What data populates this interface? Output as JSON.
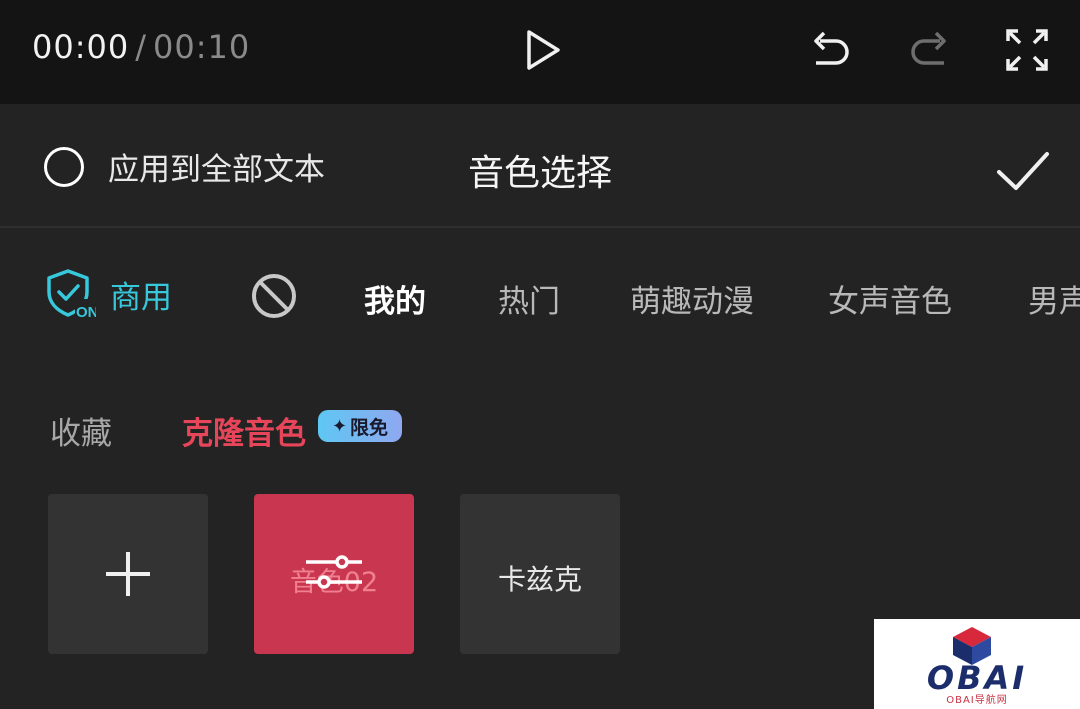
{
  "player": {
    "current_time": "00:00",
    "separator": "/",
    "total_time": "00:10"
  },
  "header": {
    "apply_all_label": "应用到全部文本",
    "title": "音色选择"
  },
  "tabs": {
    "commercial_label": "商用",
    "items": [
      {
        "label": "我的"
      },
      {
        "label": "热门"
      },
      {
        "label": "萌趣动漫"
      },
      {
        "label": "女声音色"
      },
      {
        "label": "男声"
      }
    ]
  },
  "subtabs": {
    "favorites_label": "收藏",
    "clone_label": "克隆音色",
    "badge_label": "限免"
  },
  "cards": {
    "clone_name": "音色02",
    "voice_name": "卡兹克"
  },
  "watermark": {
    "brand": "OBAI",
    "subtitle": "OBAI导航网"
  },
  "colors": {
    "accent_cyan": "#37c8dc",
    "accent_red": "#e6455a",
    "clone_card": "#c8374f"
  }
}
